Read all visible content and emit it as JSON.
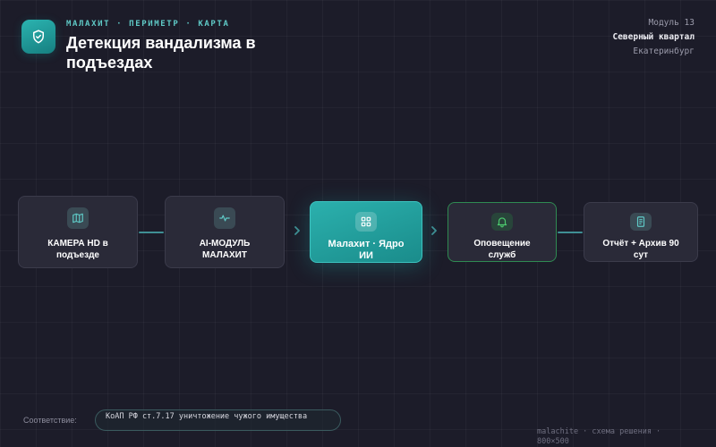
{
  "header": {
    "kicker": "МАЛАХИТ · ПЕРИМЕТР · КАРТА",
    "title": "Детекция вандализма в подъездах",
    "logo_icon": "shield-check-icon"
  },
  "meta": {
    "module": "Модуль 13",
    "district": "Северный квартал",
    "city": "Екатеринбург"
  },
  "flow": {
    "nodes": [
      {
        "label": "КАМЕРА HD в подъезде",
        "icon": "map-icon"
      },
      {
        "label": "AI-МОДУЛЬ МАЛАХИТ",
        "icon": "pulse-icon"
      },
      {
        "label": "Малахит · Ядро ИИ",
        "icon": "grid-icon"
      },
      {
        "label": "Оповещение служб",
        "icon": "bell-icon"
      },
      {
        "label": "Отчёт + Архив 90 сут",
        "icon": "document-icon"
      }
    ],
    "colors": {
      "accent": "#2bb0ad",
      "connector": "#3f8f94",
      "alert_border": "#2f8a52",
      "alert_icon": "#4cc96e"
    }
  },
  "compliance": {
    "label": "Соответствие:",
    "text": "КоАП РФ ст.7.17 уничтожение чужого имущества"
  },
  "footer": {
    "text": "malachite · схема решения · 800×500"
  }
}
